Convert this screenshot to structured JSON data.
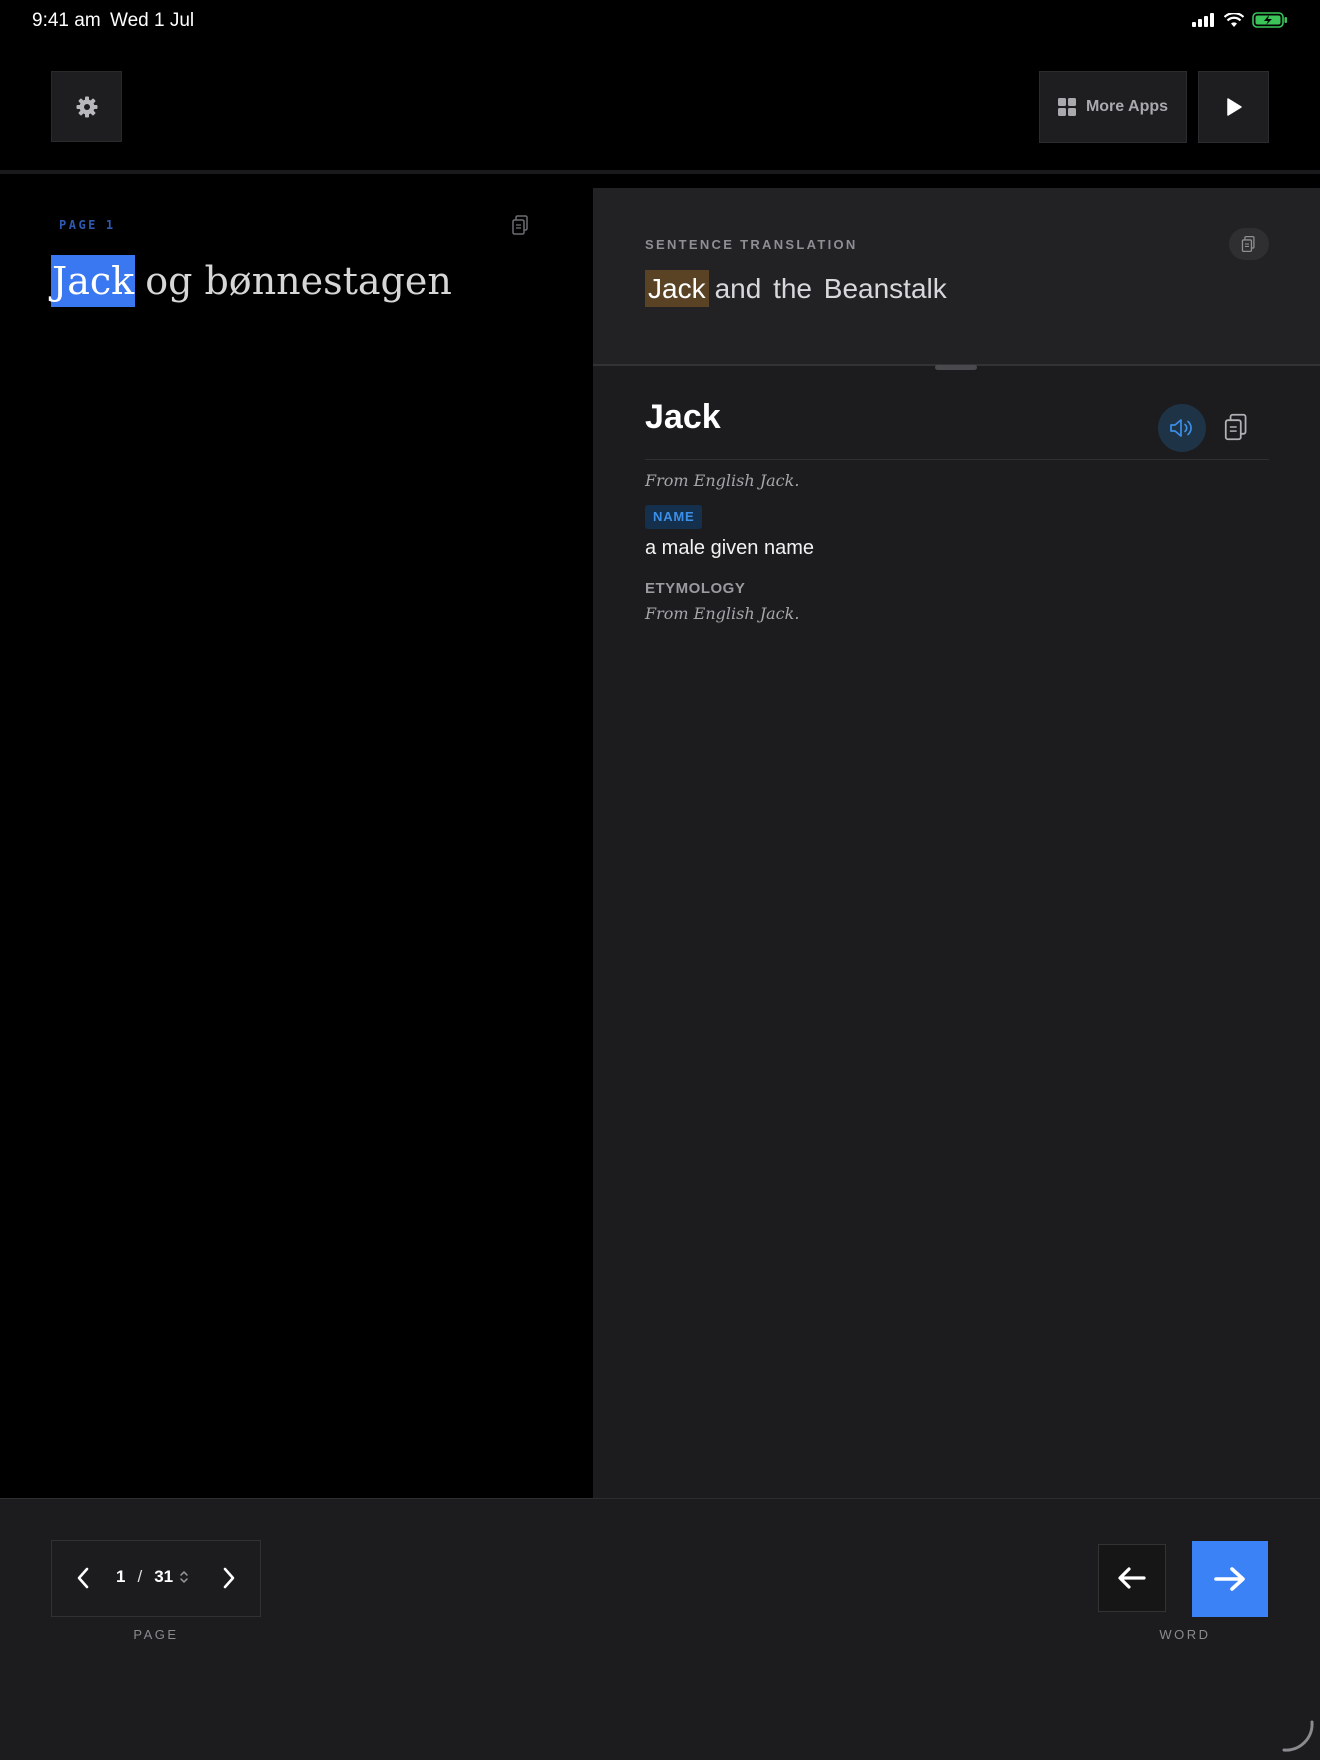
{
  "status_bar": {
    "time": "9:41 am",
    "date": "Wed 1 Jul",
    "icons": [
      "signal-icon",
      "wifi-icon",
      "battery-charging-icon"
    ],
    "battery_color": "#3bc45a"
  },
  "toolbar": {
    "settings_icon": "gear-icon",
    "more_apps_label": "More Apps",
    "more_apps_icon": "grid-icon",
    "play_icon": "play-icon"
  },
  "reader": {
    "page_label": "PAGE",
    "page_number": "1",
    "highlighted_word": "Jack",
    "rest_of_sentence": "og bønnestagen",
    "copy_icon": "copy-icon"
  },
  "translation": {
    "label": "SENTENCE TRANSLATION",
    "highlighted_word": "Jack",
    "rest_of_sentence": "and the Beanstalk",
    "copy_icon": "copy-icon"
  },
  "entry": {
    "headword": "Jack",
    "origin": "From English Jack.",
    "part_of_speech": "NAME",
    "definition": "a male given name",
    "etymology_label": "ETYMOLOGY",
    "etymology_text": "From English Jack.",
    "audio_icon": "speaker-icon",
    "copy_icon": "copy-icon"
  },
  "pager": {
    "current": "1",
    "separator": "/",
    "total": "31",
    "caption": "PAGE"
  },
  "word_nav": {
    "caption": "WORD",
    "prev_icon": "arrow-left-icon",
    "next_icon": "arrow-right-icon"
  },
  "colors": {
    "accent": "#3b82f6",
    "source_highlight": "#3a78f2",
    "translation_highlight": "#5a4325",
    "pos_badge_text": "#3b8fe6"
  }
}
